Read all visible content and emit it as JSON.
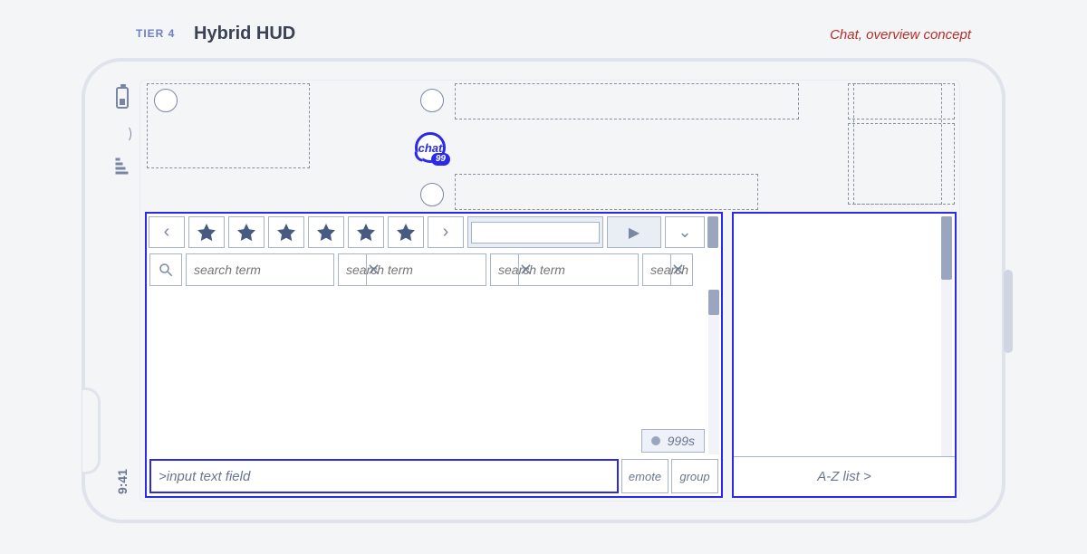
{
  "header": {
    "tier": "TIER 4",
    "title": "Hybrid HUD",
    "concept": "Chat, overview concept"
  },
  "status": {
    "time": "9:41"
  },
  "chat_bubble": {
    "label": "chat",
    "badge": "99"
  },
  "search": {
    "placeholder": "search term",
    "placeholder2": "search term",
    "placeholder3": "search term",
    "stub": "search"
  },
  "typing": {
    "label": "999s"
  },
  "input": {
    "placeholder": ">input text field"
  },
  "aux": {
    "emote": "emote",
    "group": "group"
  },
  "roster": {
    "footer": "A-Z list >"
  }
}
